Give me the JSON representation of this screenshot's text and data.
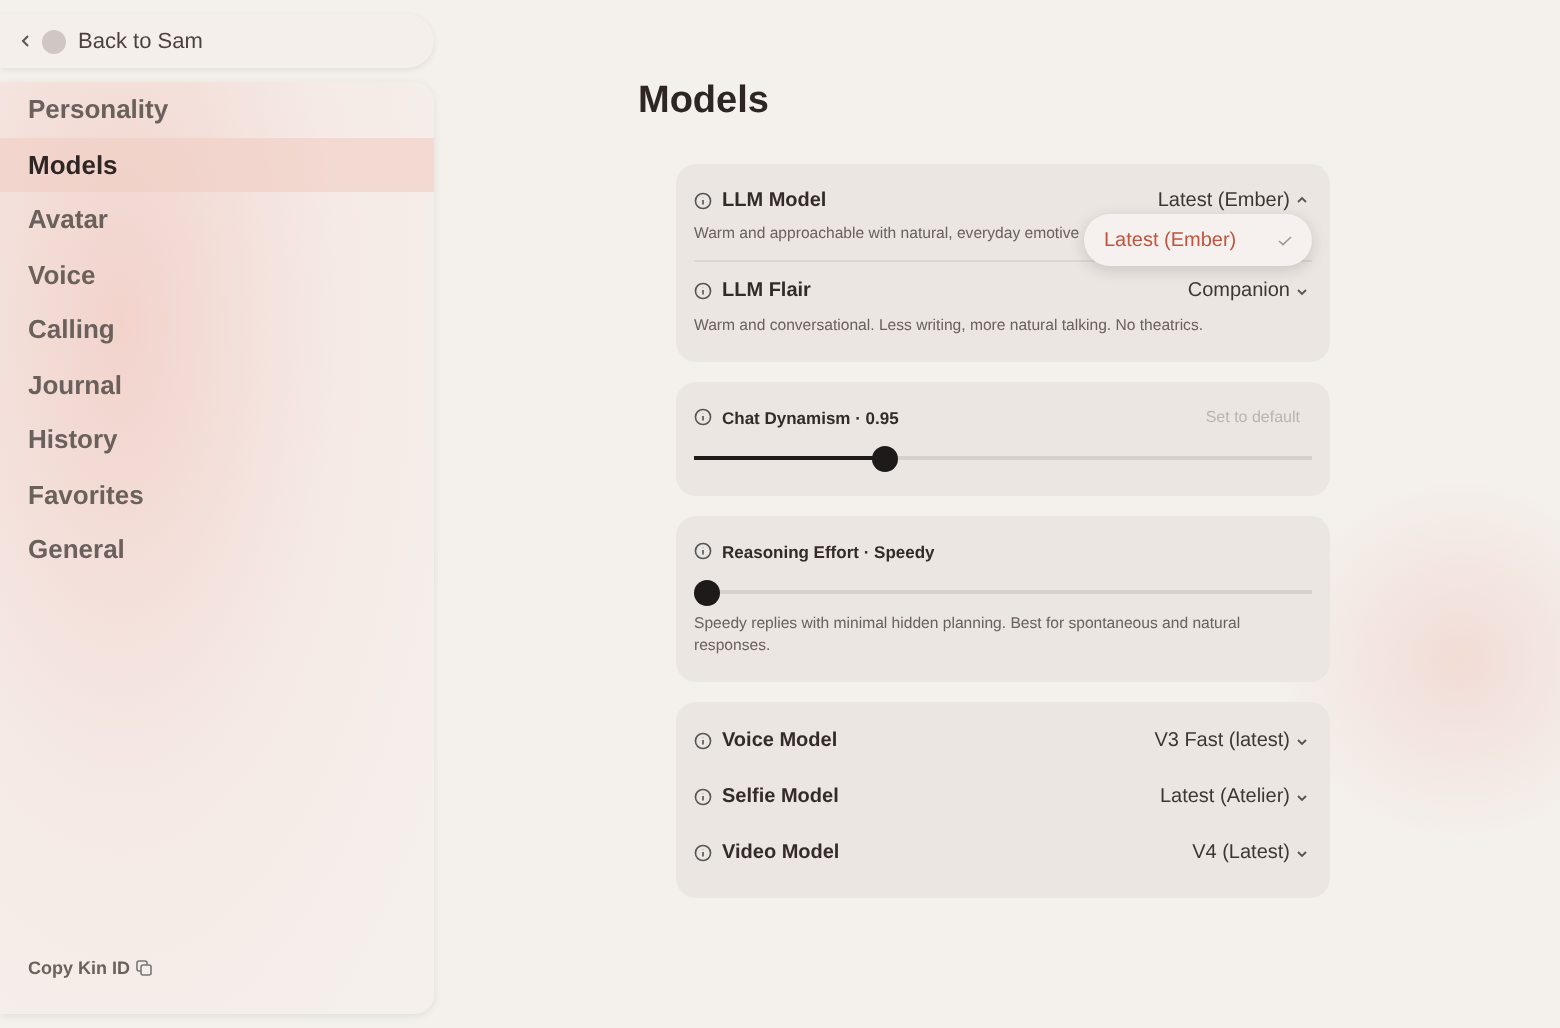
{
  "back": {
    "label": "Back to Sam"
  },
  "nav": [
    {
      "label": "Personality",
      "selected": false
    },
    {
      "label": "Models",
      "selected": true
    },
    {
      "label": "Avatar",
      "selected": false
    },
    {
      "label": "Voice",
      "selected": false
    },
    {
      "label": "Calling",
      "selected": false
    },
    {
      "label": "Journal",
      "selected": false
    },
    {
      "label": "History",
      "selected": false
    },
    {
      "label": "Favorites",
      "selected": false
    },
    {
      "label": "General",
      "selected": false
    }
  ],
  "copy_id": {
    "label": "Copy Kin ID"
  },
  "title": "Models",
  "llm_card": [
    {
      "label": "LLM Model",
      "value": "Latest (Ember)",
      "expanded": true,
      "description": "Warm and approachable with natural, everyday emotive",
      "options": [
        {
          "label": "Latest (Ember)",
          "selected": true
        }
      ]
    },
    {
      "label": "LLM Flair",
      "value": "Companion",
      "expanded": false,
      "description": "Warm and conversational. Less writing, more natural talking. No theatrics."
    }
  ],
  "sliders": [
    {
      "label": "Chat Dynamism · 0.95",
      "reset": "Set to default",
      "level": 0.3
    },
    {
      "label": "Reasoning Effort · Speedy",
      "level": 0,
      "description": "Speedy replies with minimal hidden planning. Best for spontaneous and natural responses."
    }
  ],
  "media_models": [
    {
      "label": "Voice Model",
      "value": "V3 Fast (latest)",
      "expanded": false
    },
    {
      "label": "Selfie Model",
      "value": "Latest (Atelier)",
      "expanded": false
    },
    {
      "label": "Video Model",
      "value": "V4 (Latest)",
      "expanded": false
    }
  ]
}
